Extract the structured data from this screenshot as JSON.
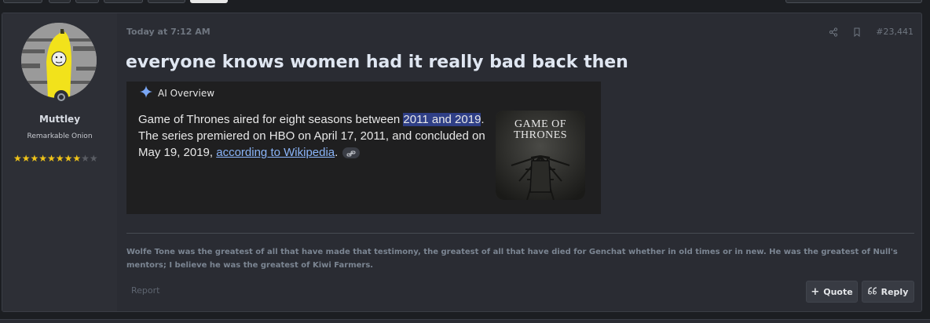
{
  "post": {
    "timestamp": "Today at 7:12 AM",
    "number": "#23,441",
    "title": "everyone knows women had it really bad back then"
  },
  "user": {
    "name": "Muttley",
    "title": "Remarkable Onion",
    "rating_stars": 8,
    "rating_max": 10
  },
  "ai_overview": {
    "header": "AI Overview",
    "text_before": "Game of Thrones aired for eight seasons between ",
    "highlight": "2011 and 2019",
    "text_after": ". The series premiered on HBO on April 17, 2011, and concluded on May 19, 2019, ",
    "link": "according to Wikipedia",
    "text_end": ".",
    "thumbnail_caption_line1": "GAME OF",
    "thumbnail_caption_line2": "THRONES"
  },
  "signature": "Wolfe Tone was the greatest of all that have made that testimony, the greatest of all that have died for Genchat whether in old times or in new. He was the greatest of Null's mentors; I believe he was the greatest of Kiwi Farmers.",
  "actions": {
    "report": "Report",
    "quote": "Quote",
    "reply": "Reply"
  },
  "colors": {
    "accent_star": "#f0c419",
    "highlight": "#2f3f86",
    "link": "#8ab4f8"
  }
}
